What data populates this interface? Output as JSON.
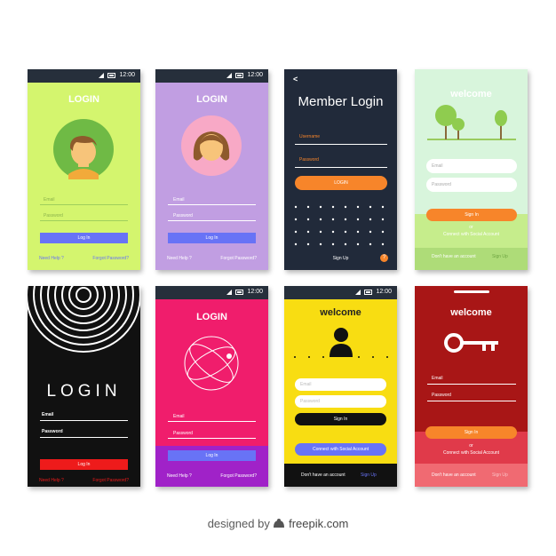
{
  "status": {
    "time": "12:00"
  },
  "card1": {
    "title": "LOGIN",
    "email": "Email",
    "password": "Password",
    "button": "Log In",
    "help": "Need Help ?",
    "forgot": "Forgot Password?"
  },
  "card2": {
    "title": "LOGIN",
    "email": "Email",
    "password": "Password",
    "button": "Log In",
    "help": "Need Help ?",
    "forgot": "Forgot Password?"
  },
  "card3": {
    "back": "<",
    "title": "Member Login",
    "username": "Username",
    "password": "Password",
    "button": "LOGIN",
    "signup": "Sign Up",
    "help": "?"
  },
  "card4": {
    "title": "welcome",
    "email": "Email",
    "password": "Password",
    "button": "Sign In",
    "or": "or",
    "social": "Connect with Social Account",
    "noaccount": "Don't have an account",
    "signup": "Sign Up"
  },
  "card5": {
    "title": "LOGIN",
    "email": "Email",
    "password": "Password",
    "button": "Log In",
    "help": "Need Help ?",
    "forgot": "Forgot Password?"
  },
  "card6": {
    "title": "LOGIN",
    "email": "Email",
    "password": "Password",
    "button": "Log In",
    "help": "Need Help ?",
    "forgot": "Forgot Password?"
  },
  "card7": {
    "title": "welcome",
    "email": "Email",
    "password": "Password",
    "button": "Sign In",
    "social": "Connect with Social Account",
    "noaccount": "Don't have an account",
    "signup": "Sign Up"
  },
  "card8": {
    "title": "welcome",
    "email": "Email",
    "password": "Password",
    "button": "Sign In",
    "or": "or",
    "social": "Connect with Social Account",
    "noaccount": "Don't have an account",
    "signup": "Sign Up"
  },
  "credit": {
    "prefix": "designed by",
    "brand": "freepik.com"
  },
  "colors": {
    "lime": "#d4f56e",
    "purple": "#c19ee2",
    "navy": "#212a3a",
    "mint": "#d8f5dc",
    "black": "#111111",
    "magenta": "#f01d6c",
    "yellow": "#f8dd12",
    "crimson": "#a81616",
    "orange": "#f7852a",
    "blue_button": "#6873f6"
  }
}
